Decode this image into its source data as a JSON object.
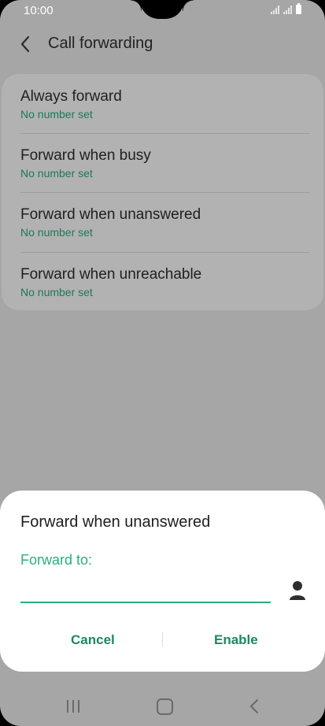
{
  "status_bar": {
    "time": "10:00"
  },
  "header": {
    "title": "Call forwarding"
  },
  "items": [
    {
      "label": "Always forward",
      "sub": "No number set"
    },
    {
      "label": "Forward when busy",
      "sub": "No number set"
    },
    {
      "label": "Forward when unanswered",
      "sub": "No number set"
    },
    {
      "label": "Forward when unreachable",
      "sub": "No number set"
    }
  ],
  "dialog": {
    "title": "Forward when unanswered",
    "field_label": "Forward to:",
    "input_value": "",
    "cancel_label": "Cancel",
    "enable_label": "Enable"
  },
  "colors": {
    "accent": "#2ab07a",
    "button": "#1b8a5e",
    "scrim": "#a6a6a6"
  }
}
